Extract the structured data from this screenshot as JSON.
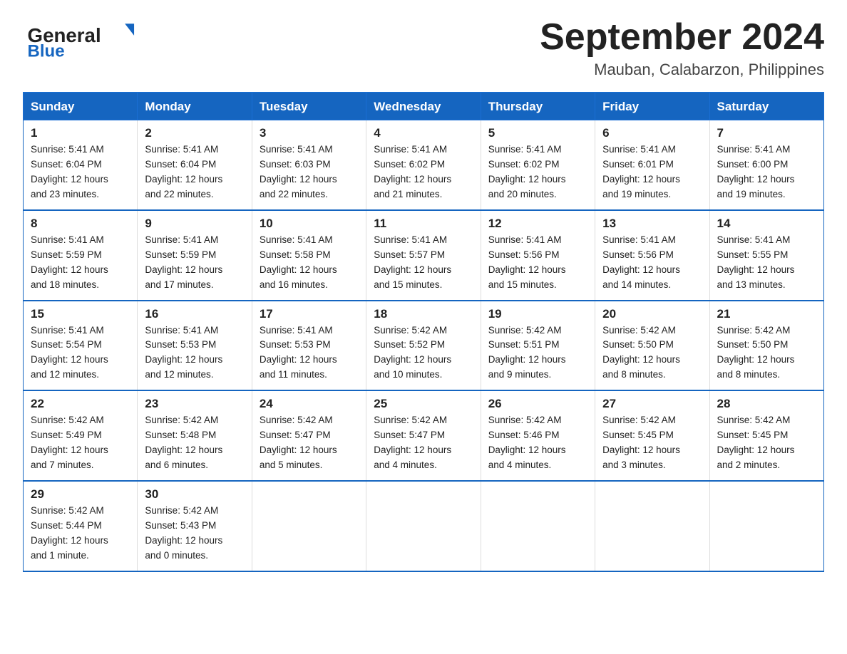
{
  "logo": {
    "name_general": "General",
    "name_blue": "Blue",
    "alt": "GeneralBlue logo"
  },
  "header": {
    "title": "September 2024",
    "subtitle": "Mauban, Calabarzon, Philippines"
  },
  "days_of_week": [
    "Sunday",
    "Monday",
    "Tuesday",
    "Wednesday",
    "Thursday",
    "Friday",
    "Saturday"
  ],
  "weeks": [
    [
      {
        "day": "1",
        "sunrise": "5:41 AM",
        "sunset": "6:04 PM",
        "daylight": "12 hours and 23 minutes."
      },
      {
        "day": "2",
        "sunrise": "5:41 AM",
        "sunset": "6:04 PM",
        "daylight": "12 hours and 22 minutes."
      },
      {
        "day": "3",
        "sunrise": "5:41 AM",
        "sunset": "6:03 PM",
        "daylight": "12 hours and 22 minutes."
      },
      {
        "day": "4",
        "sunrise": "5:41 AM",
        "sunset": "6:02 PM",
        "daylight": "12 hours and 21 minutes."
      },
      {
        "day": "5",
        "sunrise": "5:41 AM",
        "sunset": "6:02 PM",
        "daylight": "12 hours and 20 minutes."
      },
      {
        "day": "6",
        "sunrise": "5:41 AM",
        "sunset": "6:01 PM",
        "daylight": "12 hours and 19 minutes."
      },
      {
        "day": "7",
        "sunrise": "5:41 AM",
        "sunset": "6:00 PM",
        "daylight": "12 hours and 19 minutes."
      }
    ],
    [
      {
        "day": "8",
        "sunrise": "5:41 AM",
        "sunset": "5:59 PM",
        "daylight": "12 hours and 18 minutes."
      },
      {
        "day": "9",
        "sunrise": "5:41 AM",
        "sunset": "5:59 PM",
        "daylight": "12 hours and 17 minutes."
      },
      {
        "day": "10",
        "sunrise": "5:41 AM",
        "sunset": "5:58 PM",
        "daylight": "12 hours and 16 minutes."
      },
      {
        "day": "11",
        "sunrise": "5:41 AM",
        "sunset": "5:57 PM",
        "daylight": "12 hours and 15 minutes."
      },
      {
        "day": "12",
        "sunrise": "5:41 AM",
        "sunset": "5:56 PM",
        "daylight": "12 hours and 15 minutes."
      },
      {
        "day": "13",
        "sunrise": "5:41 AM",
        "sunset": "5:56 PM",
        "daylight": "12 hours and 14 minutes."
      },
      {
        "day": "14",
        "sunrise": "5:41 AM",
        "sunset": "5:55 PM",
        "daylight": "12 hours and 13 minutes."
      }
    ],
    [
      {
        "day": "15",
        "sunrise": "5:41 AM",
        "sunset": "5:54 PM",
        "daylight": "12 hours and 12 minutes."
      },
      {
        "day": "16",
        "sunrise": "5:41 AM",
        "sunset": "5:53 PM",
        "daylight": "12 hours and 12 minutes."
      },
      {
        "day": "17",
        "sunrise": "5:41 AM",
        "sunset": "5:53 PM",
        "daylight": "12 hours and 11 minutes."
      },
      {
        "day": "18",
        "sunrise": "5:42 AM",
        "sunset": "5:52 PM",
        "daylight": "12 hours and 10 minutes."
      },
      {
        "day": "19",
        "sunrise": "5:42 AM",
        "sunset": "5:51 PM",
        "daylight": "12 hours and 9 minutes."
      },
      {
        "day": "20",
        "sunrise": "5:42 AM",
        "sunset": "5:50 PM",
        "daylight": "12 hours and 8 minutes."
      },
      {
        "day": "21",
        "sunrise": "5:42 AM",
        "sunset": "5:50 PM",
        "daylight": "12 hours and 8 minutes."
      }
    ],
    [
      {
        "day": "22",
        "sunrise": "5:42 AM",
        "sunset": "5:49 PM",
        "daylight": "12 hours and 7 minutes."
      },
      {
        "day": "23",
        "sunrise": "5:42 AM",
        "sunset": "5:48 PM",
        "daylight": "12 hours and 6 minutes."
      },
      {
        "day": "24",
        "sunrise": "5:42 AM",
        "sunset": "5:47 PM",
        "daylight": "12 hours and 5 minutes."
      },
      {
        "day": "25",
        "sunrise": "5:42 AM",
        "sunset": "5:47 PM",
        "daylight": "12 hours and 4 minutes."
      },
      {
        "day": "26",
        "sunrise": "5:42 AM",
        "sunset": "5:46 PM",
        "daylight": "12 hours and 4 minutes."
      },
      {
        "day": "27",
        "sunrise": "5:42 AM",
        "sunset": "5:45 PM",
        "daylight": "12 hours and 3 minutes."
      },
      {
        "day": "28",
        "sunrise": "5:42 AM",
        "sunset": "5:45 PM",
        "daylight": "12 hours and 2 minutes."
      }
    ],
    [
      {
        "day": "29",
        "sunrise": "5:42 AM",
        "sunset": "5:44 PM",
        "daylight": "12 hours and 1 minute."
      },
      {
        "day": "30",
        "sunrise": "5:42 AM",
        "sunset": "5:43 PM",
        "daylight": "12 hours and 0 minutes."
      },
      null,
      null,
      null,
      null,
      null
    ]
  ],
  "labels": {
    "sunrise_prefix": "Sunrise: ",
    "sunset_prefix": "Sunset: ",
    "daylight_prefix": "Daylight: "
  }
}
